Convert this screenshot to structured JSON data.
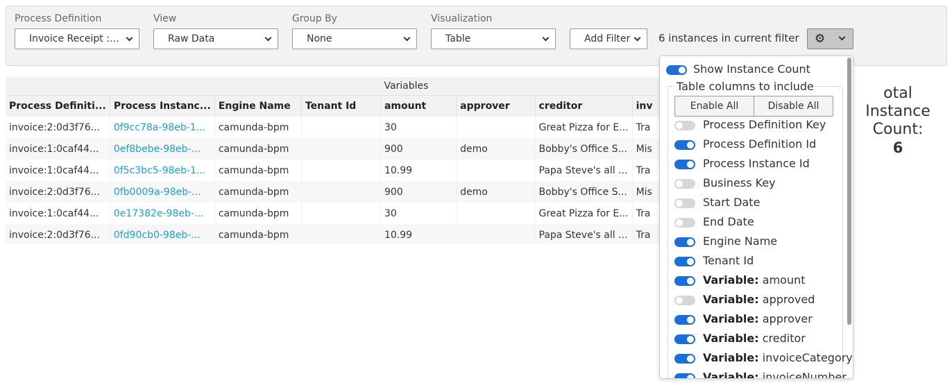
{
  "controls": {
    "process_definition": {
      "label": "Process Definition",
      "value": "Invoice Receipt : ..."
    },
    "view": {
      "label": "View",
      "value": "Raw Data"
    },
    "group_by": {
      "label": "Group By",
      "value": "None"
    },
    "visualization": {
      "label": "Visualization",
      "value": "Table"
    },
    "add_filter": "Add Filter",
    "instances_text": "6 instances in current filter",
    "settings_icon": "gear-icon"
  },
  "table": {
    "group_header": "Variables",
    "columns": [
      "Process Definiti...",
      "Process Instanc...",
      "Engine Name",
      "Tenant Id",
      "amount",
      "approver",
      "creditor",
      "inv"
    ],
    "rows": [
      [
        "invoice:2:0d3f76...",
        "0f9cc78a-98eb-1...",
        "camunda-bpm",
        "",
        "30",
        "",
        "Great Pizza for E...",
        "Tra"
      ],
      [
        "invoice:1:0caf44...",
        "0ef8bebe-98eb-...",
        "camunda-bpm",
        "",
        "900",
        "demo",
        "Bobby's Office S...",
        "Mis"
      ],
      [
        "invoice:1:0caf44...",
        "0f5c3bc5-98eb-1...",
        "camunda-bpm",
        "",
        "10.99",
        "",
        "Papa Steve's all ...",
        "Tra"
      ],
      [
        "invoice:2:0d3f76...",
        "0fb0009a-98eb-...",
        "camunda-bpm",
        "",
        "900",
        "demo",
        "Bobby's Office S...",
        "Mis"
      ],
      [
        "invoice:1:0caf44...",
        "0e17382e-98eb-...",
        "camunda-bpm",
        "",
        "30",
        "",
        "Great Pizza for E...",
        "Tra"
      ],
      [
        "invoice:2:0d3f76...",
        "0fd90cb0-98eb-...",
        "camunda-bpm",
        "",
        "10.99",
        "",
        "Papa Steve's all ...",
        "Tra"
      ]
    ]
  },
  "total": {
    "label_line1": "otal Instance",
    "label_line2": "Count:",
    "value": "6"
  },
  "settings": {
    "show_instance_count": {
      "label": "Show Instance Count",
      "on": true
    },
    "legend": "Table columns to include",
    "enable_all": "Enable All",
    "disable_all": "Disable All",
    "columns": [
      {
        "prefix": "",
        "name": "Process Definition Key",
        "on": false
      },
      {
        "prefix": "",
        "name": "Process Definition Id",
        "on": true
      },
      {
        "prefix": "",
        "name": "Process Instance Id",
        "on": true
      },
      {
        "prefix": "",
        "name": "Business Key",
        "on": false
      },
      {
        "prefix": "",
        "name": "Start Date",
        "on": false
      },
      {
        "prefix": "",
        "name": "End Date",
        "on": false
      },
      {
        "prefix": "",
        "name": "Engine Name",
        "on": true
      },
      {
        "prefix": "",
        "name": "Tenant Id",
        "on": true
      },
      {
        "prefix": "Variable:",
        "name": " amount",
        "on": true
      },
      {
        "prefix": "Variable:",
        "name": " approved",
        "on": false
      },
      {
        "prefix": "Variable:",
        "name": " approver",
        "on": true
      },
      {
        "prefix": "Variable:",
        "name": " creditor",
        "on": true
      },
      {
        "prefix": "Variable:",
        "name": " invoiceCategory",
        "on": true
      },
      {
        "prefix": "Variable:",
        "name": " invoiceNumber",
        "on": true
      }
    ]
  },
  "colors": {
    "accent": "#1c6fd8",
    "link": "#1a9fdb",
    "panel": "#f2f2f2"
  }
}
